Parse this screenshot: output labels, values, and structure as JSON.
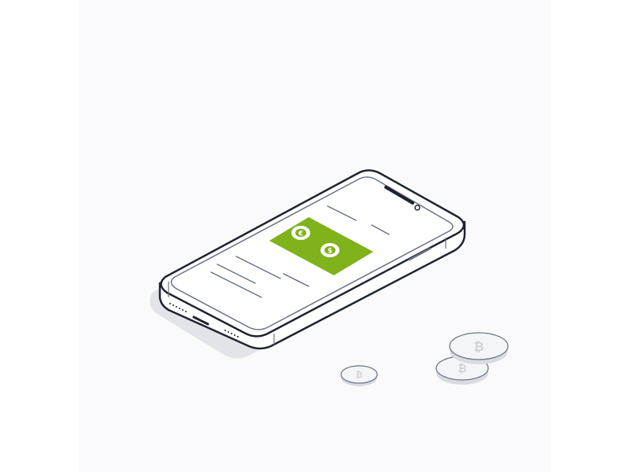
{
  "illustration": {
    "subject": "phone-with-currency-exchange",
    "icons": {
      "euro": "euro-icon",
      "dollar": "dollar-icon",
      "coin": "bitcoin-icon"
    },
    "colors": {
      "background": "#ffffff",
      "panel": "#fafafc",
      "outline": "#1f2330",
      "line": "#6a7183",
      "shadow": "#e3e4ea",
      "accent": "#7fb21b",
      "coin_fill": "#f4f5f8",
      "coin_edge": "#d8dae1"
    }
  }
}
